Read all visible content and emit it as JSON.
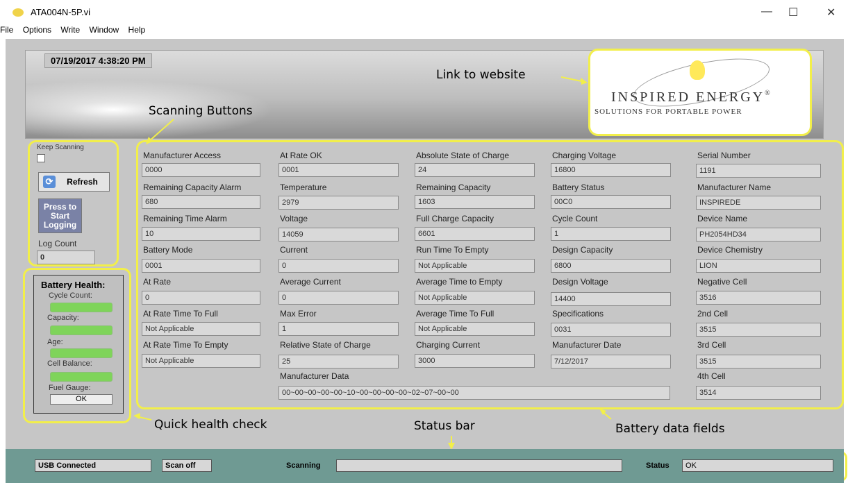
{
  "window": {
    "title": "ATA004N-5P.vi",
    "minimize": "—",
    "maximize": "☐",
    "close": "✕"
  },
  "menu": [
    "File",
    "Options",
    "Write",
    "Window",
    "Help"
  ],
  "datetime": "07/19/2017 4:38:20 PM",
  "annotations": {
    "link": "Link to website",
    "scanning": "Scanning Buttons",
    "health": "Quick health check",
    "status": "Status bar",
    "fields": "Battery data fields"
  },
  "logo": {
    "title": "INSPIRED ENERGY",
    "trademark": "®",
    "subtitle": "SOLUTIONS FOR PORTABLE POWER"
  },
  "controls": {
    "keep_scanning": "Keep Scanning",
    "refresh": "Refresh",
    "logging": "Press to Start Logging",
    "log_count_label": "Log Count",
    "log_count": "0"
  },
  "health": {
    "title": "Battery Health:",
    "items": [
      "Cycle Count:",
      "Capacity:",
      "Age:",
      "Cell Balance:",
      "Fuel Gauge:"
    ],
    "ok": "OK"
  },
  "fields": {
    "col1": [
      {
        "label": "Manufacturer Access",
        "value": "0000"
      },
      {
        "label": "Remaining Capacity Alarm",
        "value": "680"
      },
      {
        "label": "Remaining Time Alarm",
        "value": "10"
      },
      {
        "label": "Battery Mode",
        "value": "0001"
      },
      {
        "label": "At Rate",
        "value": "0"
      },
      {
        "label": "At Rate Time To Full",
        "value": "Not Applicable"
      },
      {
        "label": "At Rate Time To Empty",
        "value": "Not Applicable"
      }
    ],
    "col2": [
      {
        "label": "At Rate OK",
        "value": "0001"
      },
      {
        "label": "Temperature",
        "value": "2979"
      },
      {
        "label": "Voltage",
        "value": "14059"
      },
      {
        "label": "Current",
        "value": "0"
      },
      {
        "label": "Average Current",
        "value": "0"
      },
      {
        "label": "Max Error",
        "value": "1"
      },
      {
        "label": "Relative State of Charge",
        "value": "25"
      }
    ],
    "col3": [
      {
        "label": "Absolute State of Charge",
        "value": "24"
      },
      {
        "label": "Remaining Capacity",
        "value": "1603"
      },
      {
        "label": "Full Charge Capacity",
        "value": "6601"
      },
      {
        "label": "Run Time To Empty",
        "value": "Not Applicable"
      },
      {
        "label": "Average Time to Empty",
        "value": "Not Applicable"
      },
      {
        "label": "Average Time To Full",
        "value": "Not Applicable"
      },
      {
        "label": "Charging Current",
        "value": "3000"
      }
    ],
    "col4": [
      {
        "label": "Charging Voltage",
        "value": "16800"
      },
      {
        "label": "Battery Status",
        "value": "00C0"
      },
      {
        "label": "Cycle Count",
        "value": "1"
      },
      {
        "label": "Design Capacity",
        "value": "6800"
      },
      {
        "label": "Design Voltage",
        "value": "14400"
      },
      {
        "label": "Specifications",
        "value": "0031"
      },
      {
        "label": "Manufacturer Date",
        "value": "7/12/2017"
      }
    ],
    "col5": [
      {
        "label": "Serial Number",
        "value": "1191"
      },
      {
        "label": "Manufacturer Name",
        "value": "INSPIREDE"
      },
      {
        "label": "Device Name",
        "value": "PH2054HD34"
      },
      {
        "label": "Device Chemistry",
        "value": "LION"
      },
      {
        "label": "Negative Cell",
        "value": "3516"
      },
      {
        "label": "2nd Cell",
        "value": "3515"
      },
      {
        "label": "3rd Cell",
        "value": "3515"
      },
      {
        "label": "4th Cell",
        "value": "3514"
      }
    ],
    "manufacturer_data": {
      "label": "Manufacturer Data",
      "value": "00~00~00~00~00~10~00~00~00~00~02~07~00~00"
    }
  },
  "statusbar": {
    "usb": "USB Connected",
    "scan": "Scan off",
    "scanning_label": "Scanning",
    "scanning_value": "",
    "status_label": "Status",
    "status_value": "OK"
  },
  "colors": {
    "highlight": "#f2ef4a",
    "gauge_green": "#7fd45a",
    "statusbar": "#6f9a93"
  }
}
